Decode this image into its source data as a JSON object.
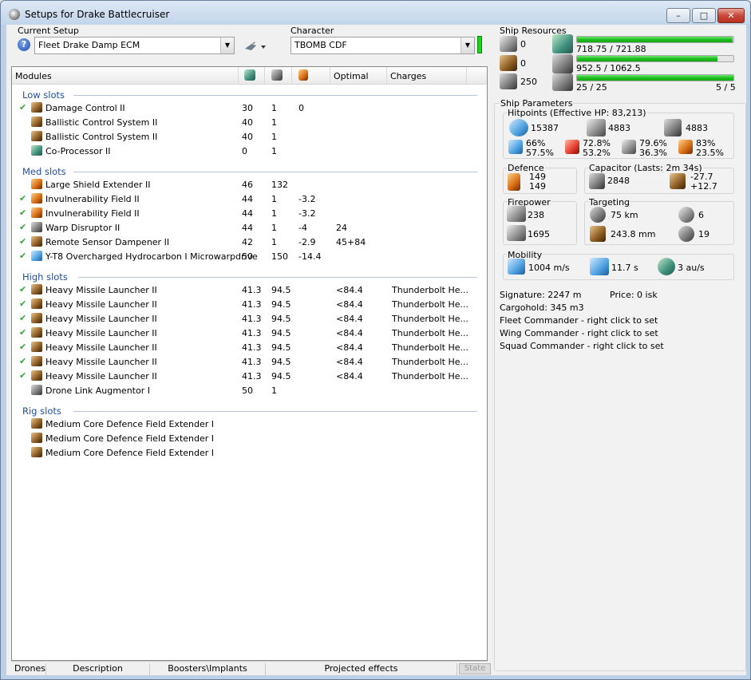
{
  "window": {
    "title": "Setups for Drake Battlecruiser",
    "min_glyph": "–",
    "max_glyph": "□",
    "close_glyph": "✕"
  },
  "setup": {
    "label": "Current Setup",
    "value": "Fleet Drake Damp ECM",
    "help_glyph": "?"
  },
  "character": {
    "label": "Character",
    "value": "TBOMB CDF"
  },
  "modules": {
    "headers": {
      "modules": "Modules",
      "optimal": "Optimal",
      "charges": "Charges"
    },
    "groups": [
      {
        "name": "Low slots",
        "rows": [
          {
            "check": "✔",
            "name": "Damage Control II",
            "c1": "30",
            "c2": "1",
            "c3": "0",
            "c4": "",
            "c5": "",
            "icon": "damage-control-icon",
            "color": "ic-brown"
          },
          {
            "check": "",
            "name": "Ballistic Control System II",
            "c1": "40",
            "c2": "1",
            "c3": "",
            "c4": "",
            "c5": "",
            "icon": "ballistic-control-icon",
            "color": "ic-brown"
          },
          {
            "check": "",
            "name": "Ballistic Control System II",
            "c1": "40",
            "c2": "1",
            "c3": "",
            "c4": "",
            "c5": "",
            "icon": "ballistic-control-icon",
            "color": "ic-brown"
          },
          {
            "check": "",
            "name": "Co-Processor II",
            "c1": "0",
            "c2": "1",
            "c3": "",
            "c4": "",
            "c5": "",
            "icon": "co-processor-icon",
            "color": "ic-green"
          }
        ]
      },
      {
        "name": "Med slots",
        "rows": [
          {
            "check": "",
            "name": "Large Shield Extender II",
            "c1": "46",
            "c2": "132",
            "c3": "",
            "c4": "",
            "c5": "",
            "icon": "shield-extender-icon",
            "color": "ic-orange"
          },
          {
            "check": "✔",
            "name": "Invulnerability Field II",
            "c1": "44",
            "c2": "1",
            "c3": "-3.2",
            "c4": "",
            "c5": "",
            "icon": "invulnerability-field-icon",
            "color": "ic-orange"
          },
          {
            "check": "✔",
            "name": "Invulnerability Field II",
            "c1": "44",
            "c2": "1",
            "c3": "-3.2",
            "c4": "",
            "c5": "",
            "icon": "invulnerability-field-icon",
            "color": "ic-orange"
          },
          {
            "check": "✔",
            "name": "Warp Disruptor II",
            "c1": "44",
            "c2": "1",
            "c3": "-4",
            "c4": "24",
            "c5": "",
            "icon": "warp-disruptor-icon",
            "color": "ic-gray"
          },
          {
            "check": "✔",
            "name": "Remote Sensor Dampener II",
            "c1": "42",
            "c2": "1",
            "c3": "-2.9",
            "c4": "45+84",
            "c5": "",
            "icon": "sensor-dampener-icon",
            "color": "ic-brown"
          },
          {
            "check": "✔",
            "name": "Y-T8 Overcharged Hydrocarbon I Microwarpdrive",
            "c1": "50",
            "c2": "150",
            "c3": "-14.4",
            "c4": "",
            "c5": "",
            "icon": "microwarpdrive-icon",
            "color": "ic-blue"
          }
        ]
      },
      {
        "name": "High slots",
        "rows": [
          {
            "check": "✔",
            "name": "Heavy Missile Launcher II",
            "c1": "41.3",
            "c2": "94.5",
            "c3": "",
            "c4": "<84.4",
            "c5": "Thunderbolt He...",
            "icon": "missile-launcher-icon",
            "color": "ic-brown"
          },
          {
            "check": "✔",
            "name": "Heavy Missile Launcher II",
            "c1": "41.3",
            "c2": "94.5",
            "c3": "",
            "c4": "<84.4",
            "c5": "Thunderbolt He...",
            "icon": "missile-launcher-icon",
            "color": "ic-brown"
          },
          {
            "check": "✔",
            "name": "Heavy Missile Launcher II",
            "c1": "41.3",
            "c2": "94.5",
            "c3": "",
            "c4": "<84.4",
            "c5": "Thunderbolt He...",
            "icon": "missile-launcher-icon",
            "color": "ic-brown"
          },
          {
            "check": "✔",
            "name": "Heavy Missile Launcher II",
            "c1": "41.3",
            "c2": "94.5",
            "c3": "",
            "c4": "<84.4",
            "c5": "Thunderbolt He...",
            "icon": "missile-launcher-icon",
            "color": "ic-brown"
          },
          {
            "check": "✔",
            "name": "Heavy Missile Launcher II",
            "c1": "41.3",
            "c2": "94.5",
            "c3": "",
            "c4": "<84.4",
            "c5": "Thunderbolt He...",
            "icon": "missile-launcher-icon",
            "color": "ic-brown"
          },
          {
            "check": "✔",
            "name": "Heavy Missile Launcher II",
            "c1": "41.3",
            "c2": "94.5",
            "c3": "",
            "c4": "<84.4",
            "c5": "Thunderbolt He...",
            "icon": "missile-launcher-icon",
            "color": "ic-brown"
          },
          {
            "check": "✔",
            "name": "Heavy Missile Launcher II",
            "c1": "41.3",
            "c2": "94.5",
            "c3": "",
            "c4": "<84.4",
            "c5": "Thunderbolt He...",
            "icon": "missile-launcher-icon",
            "color": "ic-brown"
          },
          {
            "check": "",
            "name": "Drone Link Augmentor I",
            "c1": "50",
            "c2": "1",
            "c3": "",
            "c4": "",
            "c5": "",
            "icon": "drone-link-icon",
            "color": "ic-gray"
          }
        ]
      },
      {
        "name": "Rig slots",
        "rows": [
          {
            "check": "",
            "name": "Medium Core Defence Field Extender I",
            "c1": "",
            "c2": "",
            "c3": "",
            "c4": "",
            "c5": "",
            "icon": "rig-icon",
            "color": "ic-brown"
          },
          {
            "check": "",
            "name": "Medium Core Defence Field Extender I",
            "c1": "",
            "c2": "",
            "c3": "",
            "c4": "",
            "c5": "",
            "icon": "rig-icon",
            "color": "ic-brown"
          },
          {
            "check": "",
            "name": "Medium Core Defence Field Extender I",
            "c1": "",
            "c2": "",
            "c3": "",
            "c4": "",
            "c5": "",
            "icon": "rig-icon",
            "color": "ic-brown"
          }
        ]
      }
    ]
  },
  "tabs": {
    "drones": "Drones",
    "description": "Description",
    "boosters": "Boosters\\Implants",
    "projected": "Projected effects",
    "state": "State"
  },
  "resources": {
    "title": "Ship Resources",
    "turret_hardpoints": "0",
    "launcher_hardpoints": "0",
    "drone_bay": "250",
    "cpu": {
      "text": "718.75 / 721.88",
      "fraction": 0.996
    },
    "powergrid": {
      "text": "952.5 / 1062.5",
      "fraction": 0.896
    },
    "calibration": {
      "text": "25 / 25",
      "fraction": 1.0
    },
    "calibration_slots": "5 / 5"
  },
  "params": {
    "title": "Ship Parameters",
    "hp_title": "Hitpoints (Effective HP: 83,213)",
    "shield_hp": "15387",
    "armor_hp": "4883",
    "structure_hp": "4883",
    "em_a": "66%",
    "em_b": "57.5%",
    "th_a": "72.8%",
    "th_b": "53.2%",
    "ki_a": "79.6%",
    "ki_b": "36.3%",
    "ex_a": "83%",
    "ex_b": "23.5%",
    "defence_title": "Defence",
    "defence_a": "149",
    "defence_b": "149",
    "cap_title": "Capacitor (Lasts: 2m 34s)",
    "cap_amount": "2848",
    "cap_a": "-27.7",
    "cap_b": "+12.7",
    "fire_title": "Firepower",
    "fire_volley": "238",
    "fire_dps": "1695",
    "target_title": "Targeting",
    "target_range": "75 km",
    "target_count": "6",
    "target_res": "243.8 mm",
    "target_sensor": "19",
    "mob_title": "Mobility",
    "speed": "1004 m/s",
    "align": "11.7 s",
    "warp": "3 au/s",
    "signature": "Signature: 2247 m",
    "price": "Price: 0 isk",
    "cargo": "Cargohold: 345 m3",
    "fleet": "Fleet Commander - right click to set",
    "wing": "Wing Commander - right click to set",
    "squad": "Squad Commander - right click to set"
  }
}
